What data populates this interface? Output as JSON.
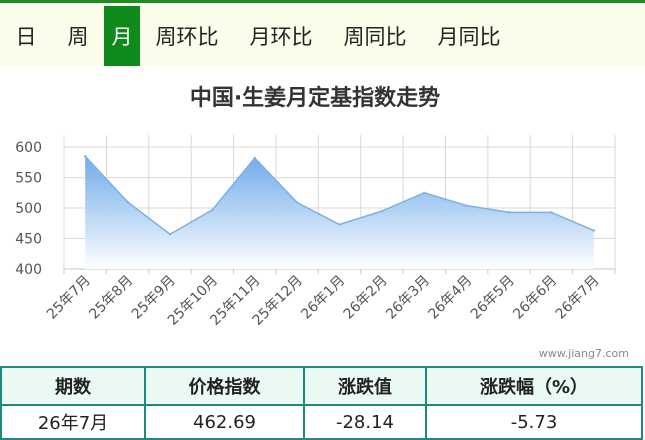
{
  "tabs": [
    {
      "label": "日",
      "active": false
    },
    {
      "label": "周",
      "active": false
    },
    {
      "label": "月",
      "active": true
    },
    {
      "label": "周环比",
      "active": false
    },
    {
      "label": "月环比",
      "active": false
    },
    {
      "label": "周同比",
      "active": false
    },
    {
      "label": "月同比",
      "active": false
    }
  ],
  "chart_data": {
    "type": "area",
    "title": "中国·生姜月定基指数走势",
    "categories": [
      "25年7月",
      "25年8月",
      "25年9月",
      "25年10月",
      "25年11月",
      "25年12月",
      "26年1月",
      "26年2月",
      "26年3月",
      "26年4月",
      "26年5月",
      "26年6月",
      "26年7月"
    ],
    "series": [
      {
        "values": [
          585,
          510,
          457,
          497,
          582,
          509,
          473,
          495,
          525,
          504,
          493,
          493,
          463
        ]
      }
    ],
    "y_ticks": [
      "600",
      "550",
      "500",
      "450",
      "400"
    ],
    "ylim": [
      400,
      610
    ],
    "grid": true,
    "colors": {
      "line": "#7fb0e0",
      "fill_top": "#6aa8ea",
      "fill_bottom": "#ffffff",
      "grid": "#d9d9d9"
    }
  },
  "watermark": "www.jiang7.com",
  "table": {
    "headers": [
      "期数",
      "价格指数",
      "涨跌值",
      "涨跌幅（%）"
    ],
    "row": [
      "26年7月",
      "462.69",
      "-28.14",
      "-5.73"
    ]
  }
}
